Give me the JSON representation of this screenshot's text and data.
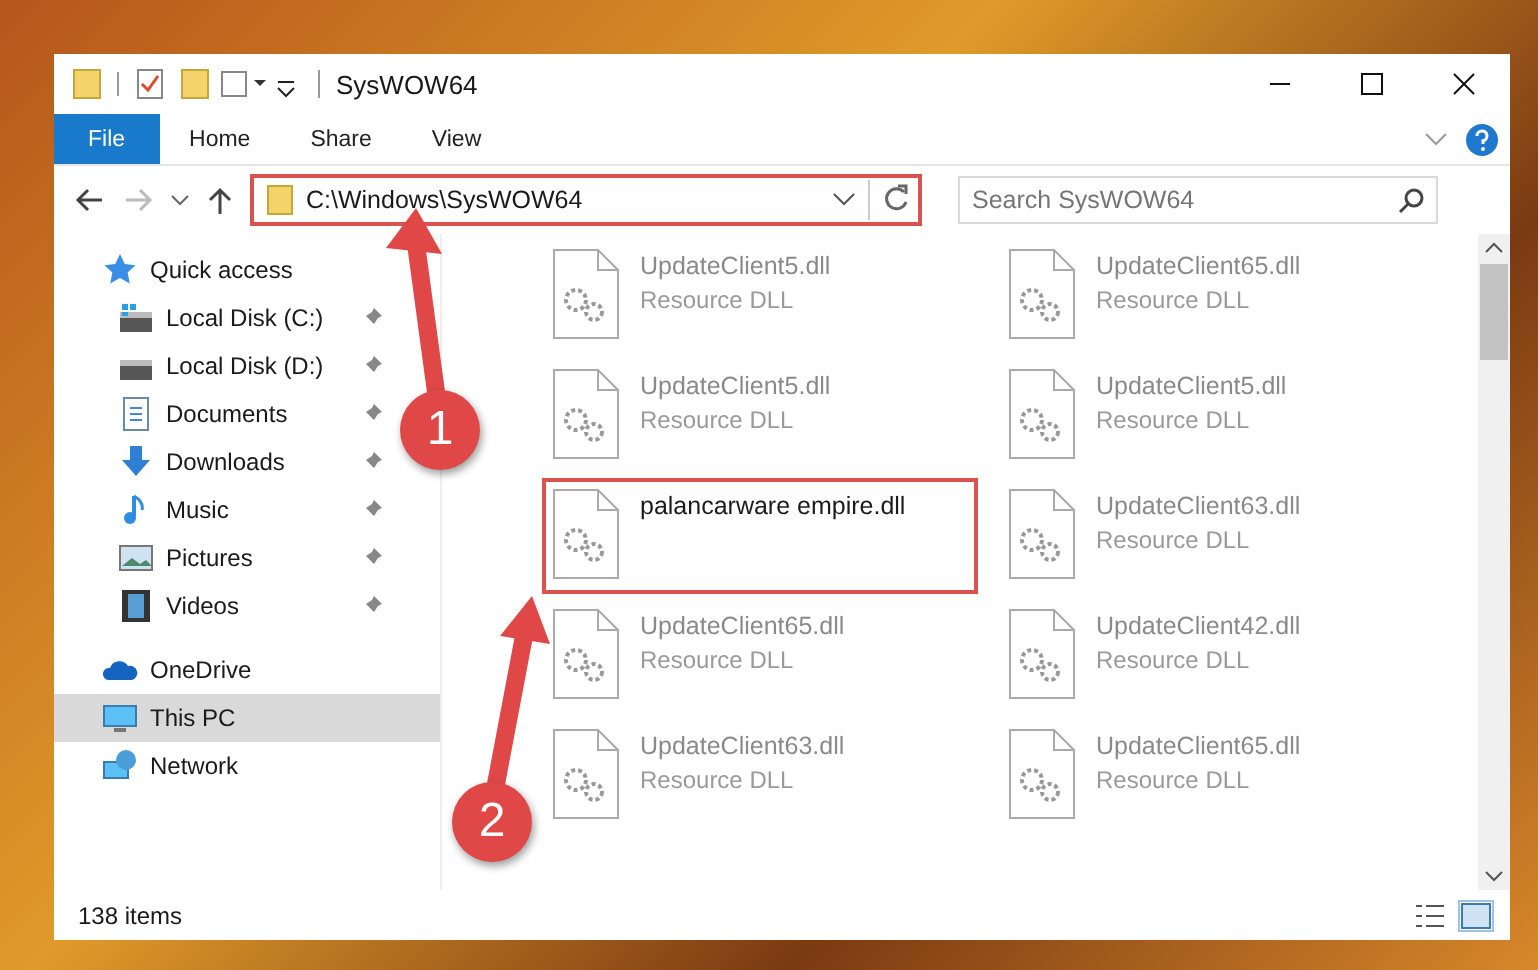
{
  "window": {
    "title": "SysWOW64"
  },
  "ribbon": {
    "tabs": [
      {
        "label": "File",
        "kind": "file",
        "selected": false
      },
      {
        "label": "Home",
        "kind": "tab",
        "selected": false
      },
      {
        "label": "Share",
        "kind": "tab",
        "selected": false
      },
      {
        "label": "View",
        "kind": "tab",
        "selected": false
      }
    ]
  },
  "address_bar": {
    "path": "C:\\Windows\\SysWOW64"
  },
  "search": {
    "placeholder": "Search SysWOW64"
  },
  "sidebar": {
    "items": [
      {
        "label": "Quick access",
        "kind": "star",
        "selected": false,
        "pinned": false,
        "children": [
          {
            "label": "Local Disk (C:)",
            "kind": "drive-c",
            "selected": false,
            "pinned": true
          },
          {
            "label": "Local Disk (D:)",
            "kind": "drive",
            "selected": false,
            "pinned": true
          },
          {
            "label": "Documents",
            "kind": "documents",
            "selected": false,
            "pinned": true
          },
          {
            "label": "Downloads",
            "kind": "downloads",
            "selected": false,
            "pinned": true
          },
          {
            "label": "Music",
            "kind": "music",
            "selected": false,
            "pinned": true
          },
          {
            "label": "Pictures",
            "kind": "pictures",
            "selected": false,
            "pinned": true
          },
          {
            "label": "Videos",
            "kind": "videos",
            "selected": false,
            "pinned": true
          }
        ]
      },
      {
        "label": "OneDrive",
        "kind": "cloud",
        "selected": false,
        "pinned": false
      },
      {
        "label": "This PC",
        "kind": "pc",
        "selected": true,
        "pinned": false
      },
      {
        "label": "Network",
        "kind": "network",
        "selected": false,
        "pinned": false
      }
    ]
  },
  "files": [
    {
      "name": "UpdateClient5.dll",
      "type": "Resource DLL",
      "highlighted": false
    },
    {
      "name": "UpdateClient65.dll",
      "type": "Resource DLL",
      "highlighted": false
    },
    {
      "name": "UpdateClient5.dll",
      "type": "Resource DLL",
      "highlighted": false
    },
    {
      "name": "UpdateClient5.dll",
      "type": "Resource DLL",
      "highlighted": false
    },
    {
      "name": "palancarware empire.dll",
      "highlighted": true
    },
    {
      "name": "UpdateClient63.dll",
      "type": "Resource DLL",
      "highlighted": false
    },
    {
      "name": "UpdateClient65.dll",
      "type": "Resource DLL",
      "highlighted": false
    },
    {
      "name": "UpdateClient42.dll",
      "type": "Resource DLL",
      "highlighted": false
    },
    {
      "name": "UpdateClient63.dll",
      "type": "Resource DLL",
      "highlighted": false
    },
    {
      "name": "UpdateClient65.dll",
      "type": "Resource DLL",
      "highlighted": false
    }
  ],
  "annotations": [
    {
      "label": "1"
    },
    {
      "label": "2"
    }
  ],
  "status_bar": {
    "count": "138 items"
  }
}
